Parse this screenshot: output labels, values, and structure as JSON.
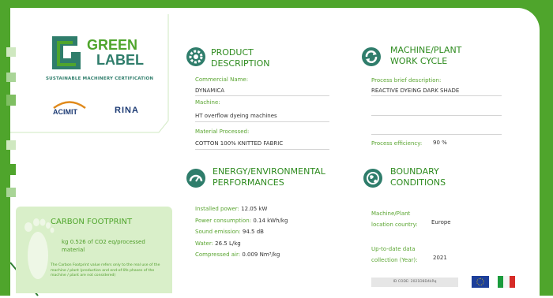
{
  "logo": {
    "line1": "GREEN",
    "line2": "LABEL",
    "tagline": "SUSTAINABLE MACHINERY CERTIFICATION"
  },
  "partners": {
    "acimit": "ACIMIT",
    "rina": "RINA"
  },
  "product": {
    "heading_line1": "PRODUCT",
    "heading_line2": "DESCRIPTION",
    "commercial_name_label": "Commercial Name:",
    "commercial_name_value": "DYNAMICA",
    "machine_label": "Machine:",
    "machine_value": "HT overflow dyeing machines",
    "material_label": "Material Processed:",
    "material_value": "COTTON 100% KNITTED FABRIC"
  },
  "work_cycle": {
    "heading_line1": "MACHINE/PLANT",
    "heading_line2": "WORK CYCLE",
    "process_label": "Process brief description:",
    "process_value": "REACTIVE DYEING DARK SHADE",
    "efficiency_label": "Process efficiency:",
    "efficiency_value": "90 %"
  },
  "energy": {
    "heading_line1": "ENERGY/ENVIRONMENTAL",
    "heading_line2": "PERFORMANCES",
    "installed_label": "Installed power:",
    "installed_value": "12.05 kW",
    "consumption_label": "Power consumption:",
    "consumption_value": "0.14 kWh/kg",
    "sound_label": "Sound emission:",
    "sound_value": "94.5 dB",
    "water_label": "Water:",
    "water_value": "26.5 L/kg",
    "air_label": "Compressed air:",
    "air_value": "0.009 Nm³/kg"
  },
  "boundary": {
    "heading_line1": "BOUNDARY",
    "heading_line2": "CONDITIONS",
    "location_label_line1": "Machine/Plant",
    "location_label_line2": "location country:",
    "location_value": "Europe",
    "year_label_line1": "Up-to-date data",
    "year_label_line2": "collection (Year):",
    "year_value": "2021"
  },
  "carbon": {
    "title": "CARBON FOOTPRINT",
    "value": "kg 0.526 of CO2 eq/processed material",
    "note": "The Carbon Footprint value refers only to the real use of the machine / plant (production and end-of-life phases of the machine / plant are not considered)"
  },
  "id_code": "ID CODE: 2021D8D4kRq",
  "colors": {
    "brand_green": "#4fa52c",
    "dark_teal": "#2f7d6b",
    "panel_green": "#d9efc9"
  },
  "icons": [
    "product-gear-icon",
    "cycle-arrows-icon",
    "gauge-icon",
    "globe-icon",
    "footprint-icon",
    "eu-flag-icon",
    "italy-flag-icon"
  ]
}
